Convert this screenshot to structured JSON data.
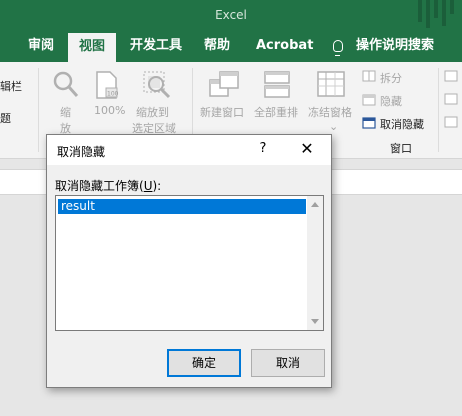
{
  "app": {
    "title": "Excel"
  },
  "ribbon_tabs": [
    "审阅",
    "视图",
    "开发工具",
    "帮助",
    "Acrobat",
    "操作说明搜索"
  ],
  "ribbon": {
    "left_cut_labels": [
      "辑栏",
      "题"
    ],
    "zoom": {
      "label1": "缩",
      "label2": "放"
    },
    "zoom100": {
      "label": "100%"
    },
    "zoom_selection": {
      "line1": "缩放到",
      "line2": "选定区域"
    },
    "new_window": {
      "label": "新建窗口"
    },
    "arrange_all": {
      "label": "全部重排"
    },
    "freeze_panes": {
      "label": "冻结窗格"
    },
    "split": {
      "label": "拆分"
    },
    "hide": {
      "label": "隐藏"
    },
    "unhide": {
      "label": "取消隐藏"
    },
    "group_window_label": "窗口"
  },
  "dialog": {
    "title": "取消隐藏",
    "help": "?",
    "close": "✕",
    "list_label_prefix": "取消隐藏工作簿(",
    "list_label_key": "U",
    "list_label_suffix": "):",
    "workbooks": [
      "result"
    ],
    "selected_index": 0,
    "ok_label": "确定",
    "cancel_label": "取消"
  },
  "colors": {
    "accent": "#217346",
    "selection": "#0078d7"
  }
}
